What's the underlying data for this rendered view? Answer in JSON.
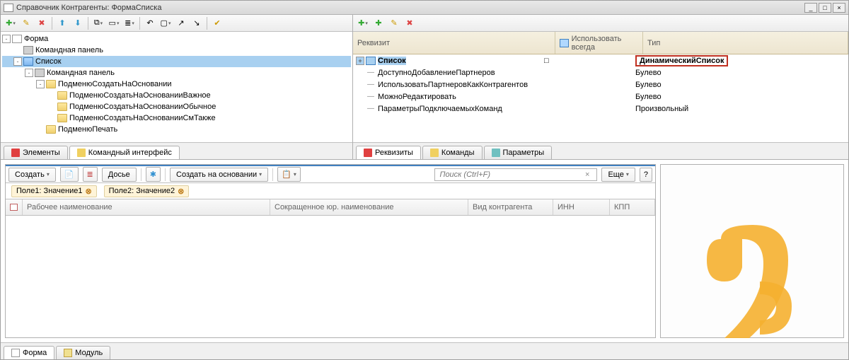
{
  "window": {
    "title": "Справочник Контрагенты: ФормаСписка"
  },
  "left": {
    "tree": [
      {
        "depth": 0,
        "exp": "-",
        "icon": "form",
        "label": "Форма"
      },
      {
        "depth": 1,
        "exp": "",
        "icon": "cmd",
        "label": "Командная панель"
      },
      {
        "depth": 1,
        "exp": "-",
        "icon": "list",
        "label": "Список",
        "selected": true
      },
      {
        "depth": 2,
        "exp": "-",
        "icon": "cmd",
        "label": "Командная панель"
      },
      {
        "depth": 3,
        "exp": "-",
        "icon": "folder",
        "label": "ПодменюСоздатьНаОсновании"
      },
      {
        "depth": 4,
        "exp": "",
        "icon": "folder",
        "label": "ПодменюСоздатьНаОснованииВажное"
      },
      {
        "depth": 4,
        "exp": "",
        "icon": "folder",
        "label": "ПодменюСоздатьНаОснованииОбычное"
      },
      {
        "depth": 4,
        "exp": "",
        "icon": "folder",
        "label": "ПодменюСоздатьНаОснованииСмТакже"
      },
      {
        "depth": 3,
        "exp": "",
        "icon": "folder",
        "label": "ПодменюПечать"
      }
    ],
    "tabs": {
      "elements": "Элементы",
      "cmdInterface": "Командный интерфейс"
    }
  },
  "right": {
    "header": {
      "col1": "Реквизит",
      "col2": "Использовать всегда",
      "col3": "Тип"
    },
    "rows": [
      {
        "exp": "+",
        "icon": "list",
        "name": "Список",
        "use": "□",
        "type": "ДинамическийСписок",
        "selected": true,
        "highlight": true
      },
      {
        "exp": "",
        "icon": "dash",
        "name": "ДоступноДобавлениеПартнеров",
        "use": "",
        "type": "Булево"
      },
      {
        "exp": "",
        "icon": "dash",
        "name": "ИспользоватьПартнеровКакКонтрагентов",
        "use": "",
        "type": "Булево"
      },
      {
        "exp": "",
        "icon": "dash",
        "name": "МожноРедактировать",
        "use": "",
        "type": "Булево"
      },
      {
        "exp": "",
        "icon": "dash",
        "name": "ПараметрыПодключаемыхКоманд",
        "use": "",
        "type": "Произвольный"
      }
    ],
    "tabs": {
      "requisites": "Реквизиты",
      "commands": "Команды",
      "params": "Параметры"
    }
  },
  "preview": {
    "buttons": {
      "create": "Создать",
      "dossier": "Досье",
      "createBased": "Создать на основании"
    },
    "search": {
      "placeholder": "Поиск (Ctrl+F)"
    },
    "more": "Еще",
    "help": "?",
    "filters": {
      "f1": "Поле1: Значение1",
      "f2": "Поле2: Значение2"
    },
    "columns": {
      "c1": "Рабочее наименование",
      "c2": "Сокращенное юр. наименование",
      "c3": "Вид контрагента",
      "c4": "ИНН",
      "c5": "КПП"
    }
  },
  "bottomTabs": {
    "form": "Форма",
    "module": "Модуль"
  }
}
